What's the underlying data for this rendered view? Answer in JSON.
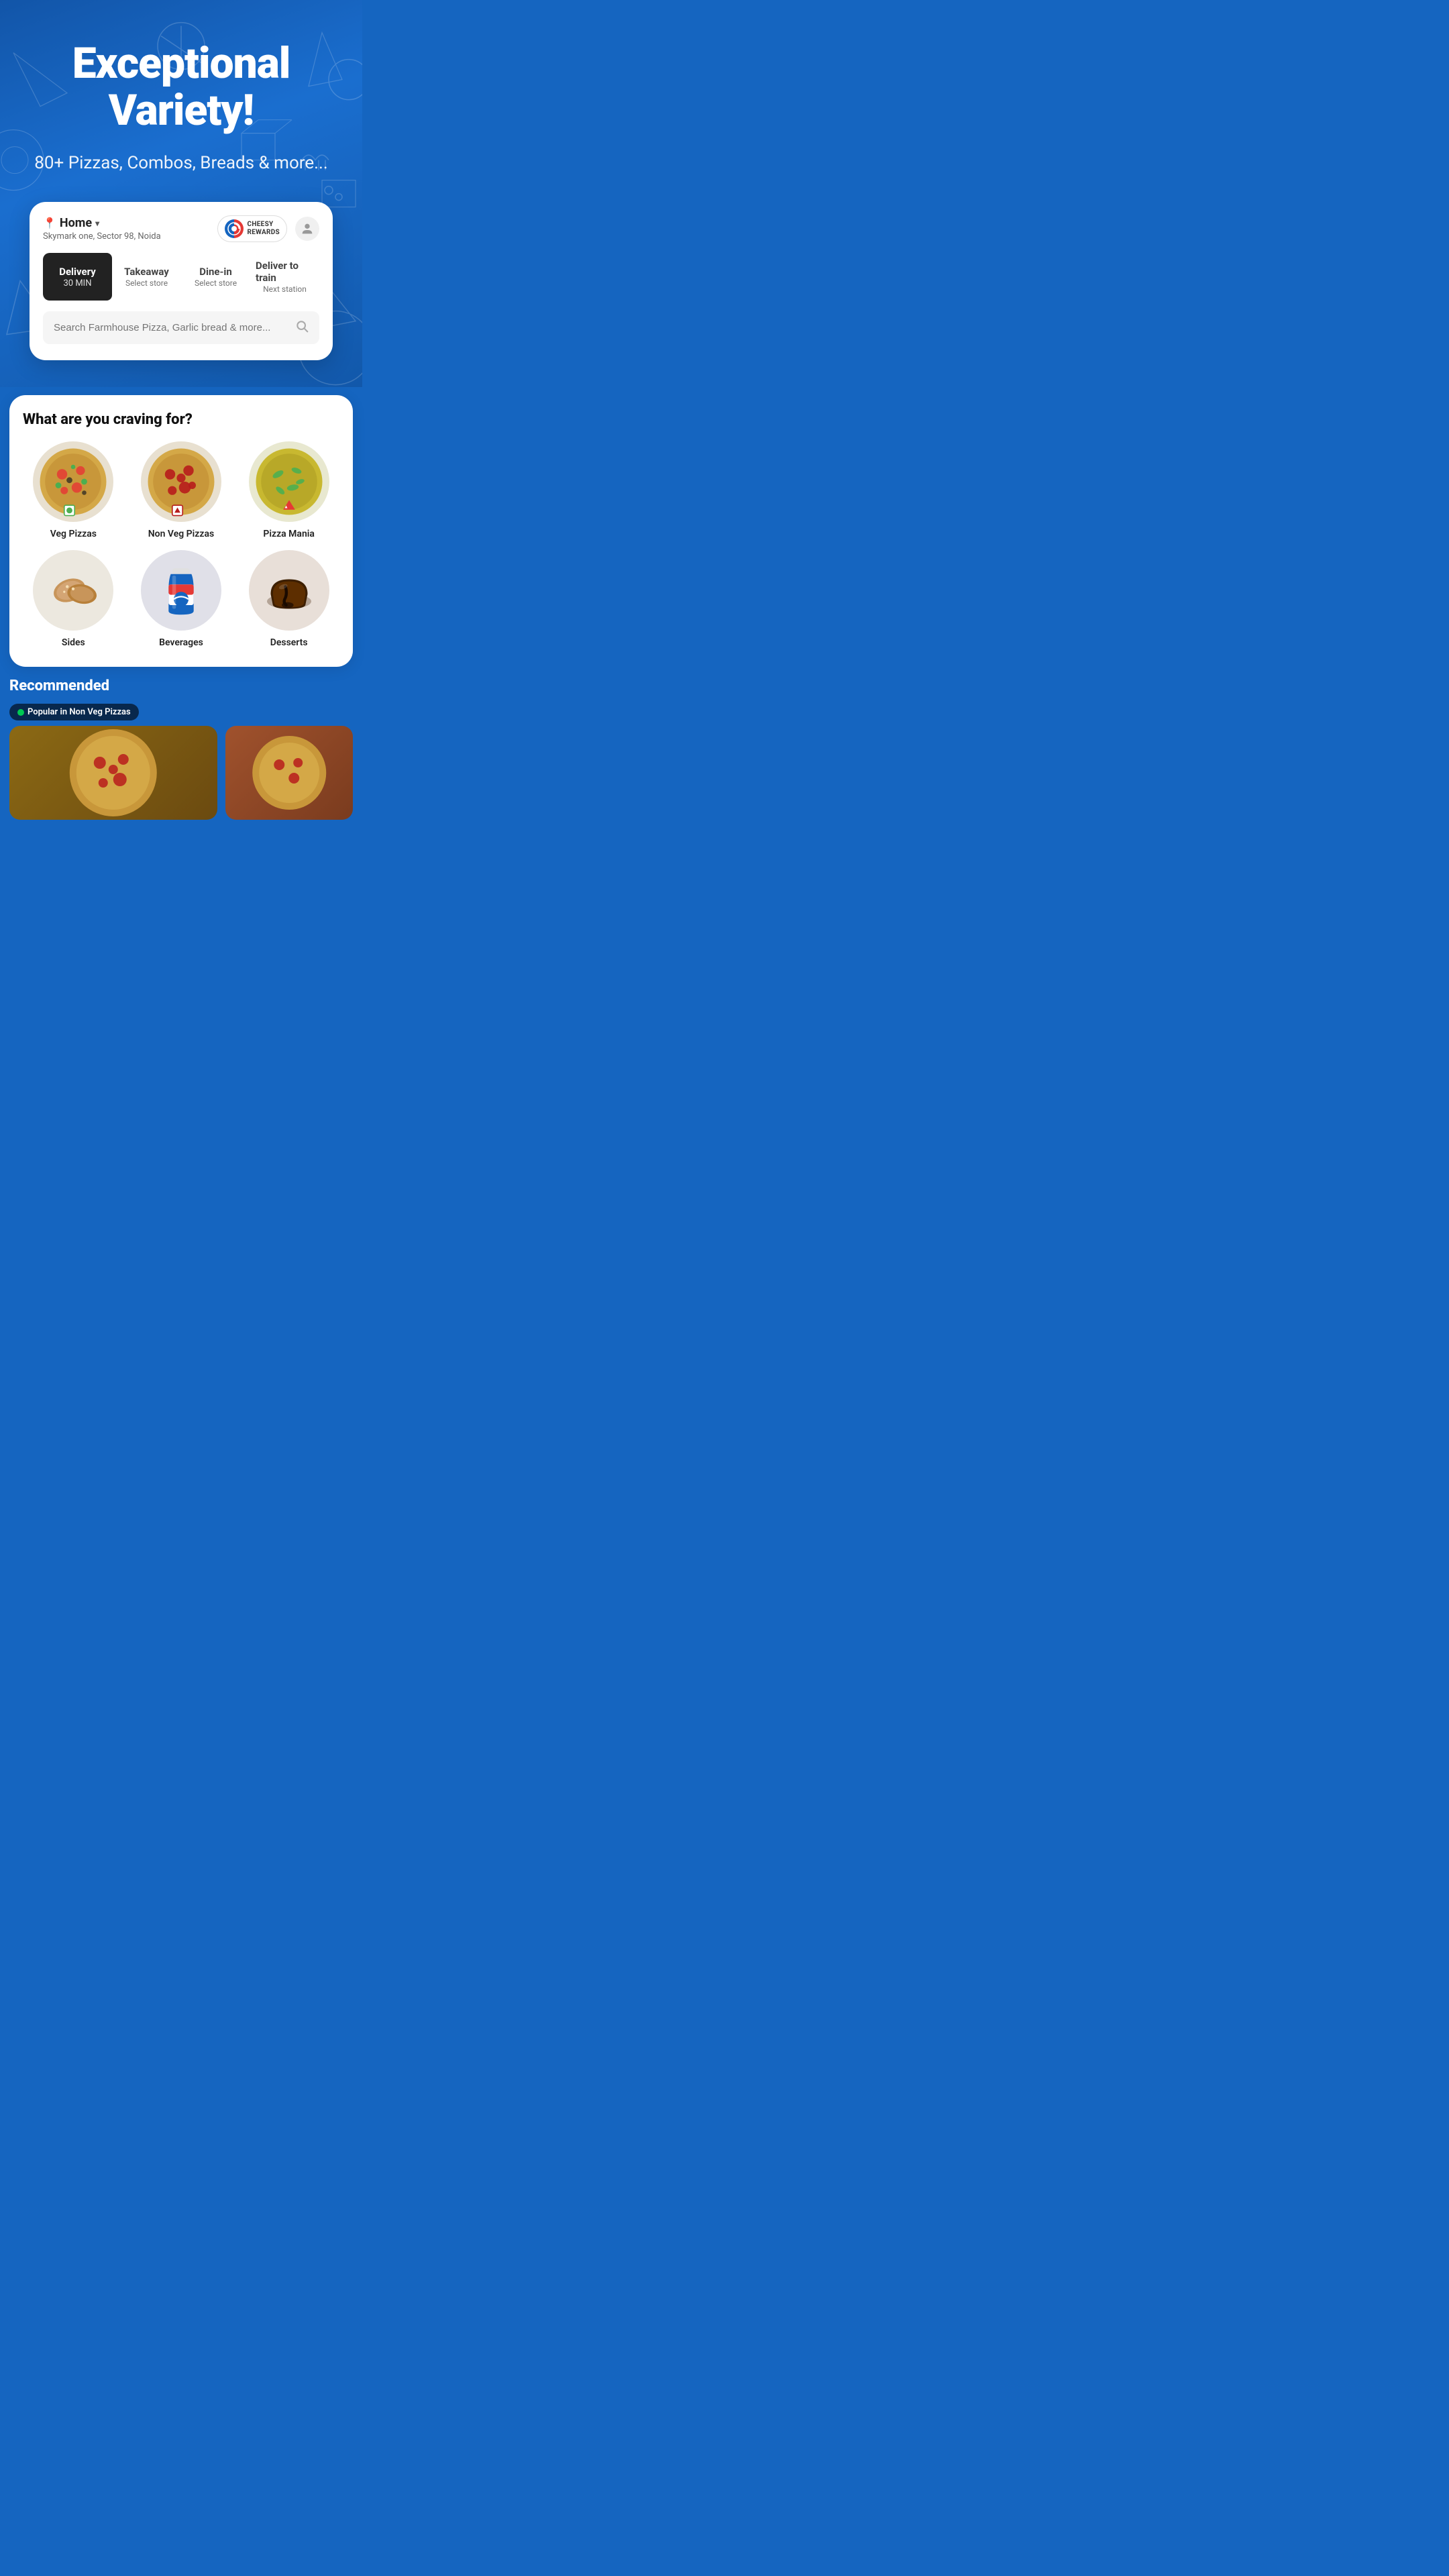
{
  "hero": {
    "title": "Exceptional Variety!",
    "subtitle": "80+ Pizzas, Combos, Breads & more...",
    "bg_color": "#1565C0"
  },
  "header": {
    "location_label": "Home",
    "location_address": "Skymark one, Sector 98, Noida",
    "rewards_label": "CHEESY\nREWARDS",
    "profile_icon": "👤"
  },
  "tabs": [
    {
      "label": "Delivery",
      "sublabel": "30 MIN",
      "active": true
    },
    {
      "label": "Takeaway",
      "sublabel": "Select store",
      "active": false
    },
    {
      "label": "Dine-in",
      "sublabel": "Select store",
      "active": false
    },
    {
      "label": "Deliver to train",
      "sublabel": "Next station",
      "active": false
    }
  ],
  "search": {
    "placeholder": "Search Farmhouse Pizza, Garlic bread & more..."
  },
  "craving": {
    "title": "What are you craving for?",
    "items": [
      {
        "label": "Veg Pizzas",
        "emoji": "🍕"
      },
      {
        "label": "Non Veg Pizzas",
        "emoji": "🍕"
      },
      {
        "label": "Pizza Mania",
        "emoji": "🍕"
      },
      {
        "label": "Sides",
        "emoji": "🥐"
      },
      {
        "label": "Beverages",
        "emoji": "🥤"
      },
      {
        "label": "Desserts",
        "emoji": "🍫"
      }
    ]
  },
  "recommended": {
    "title": "Recommended",
    "badge": "Popular in Non Veg Pizzas"
  }
}
